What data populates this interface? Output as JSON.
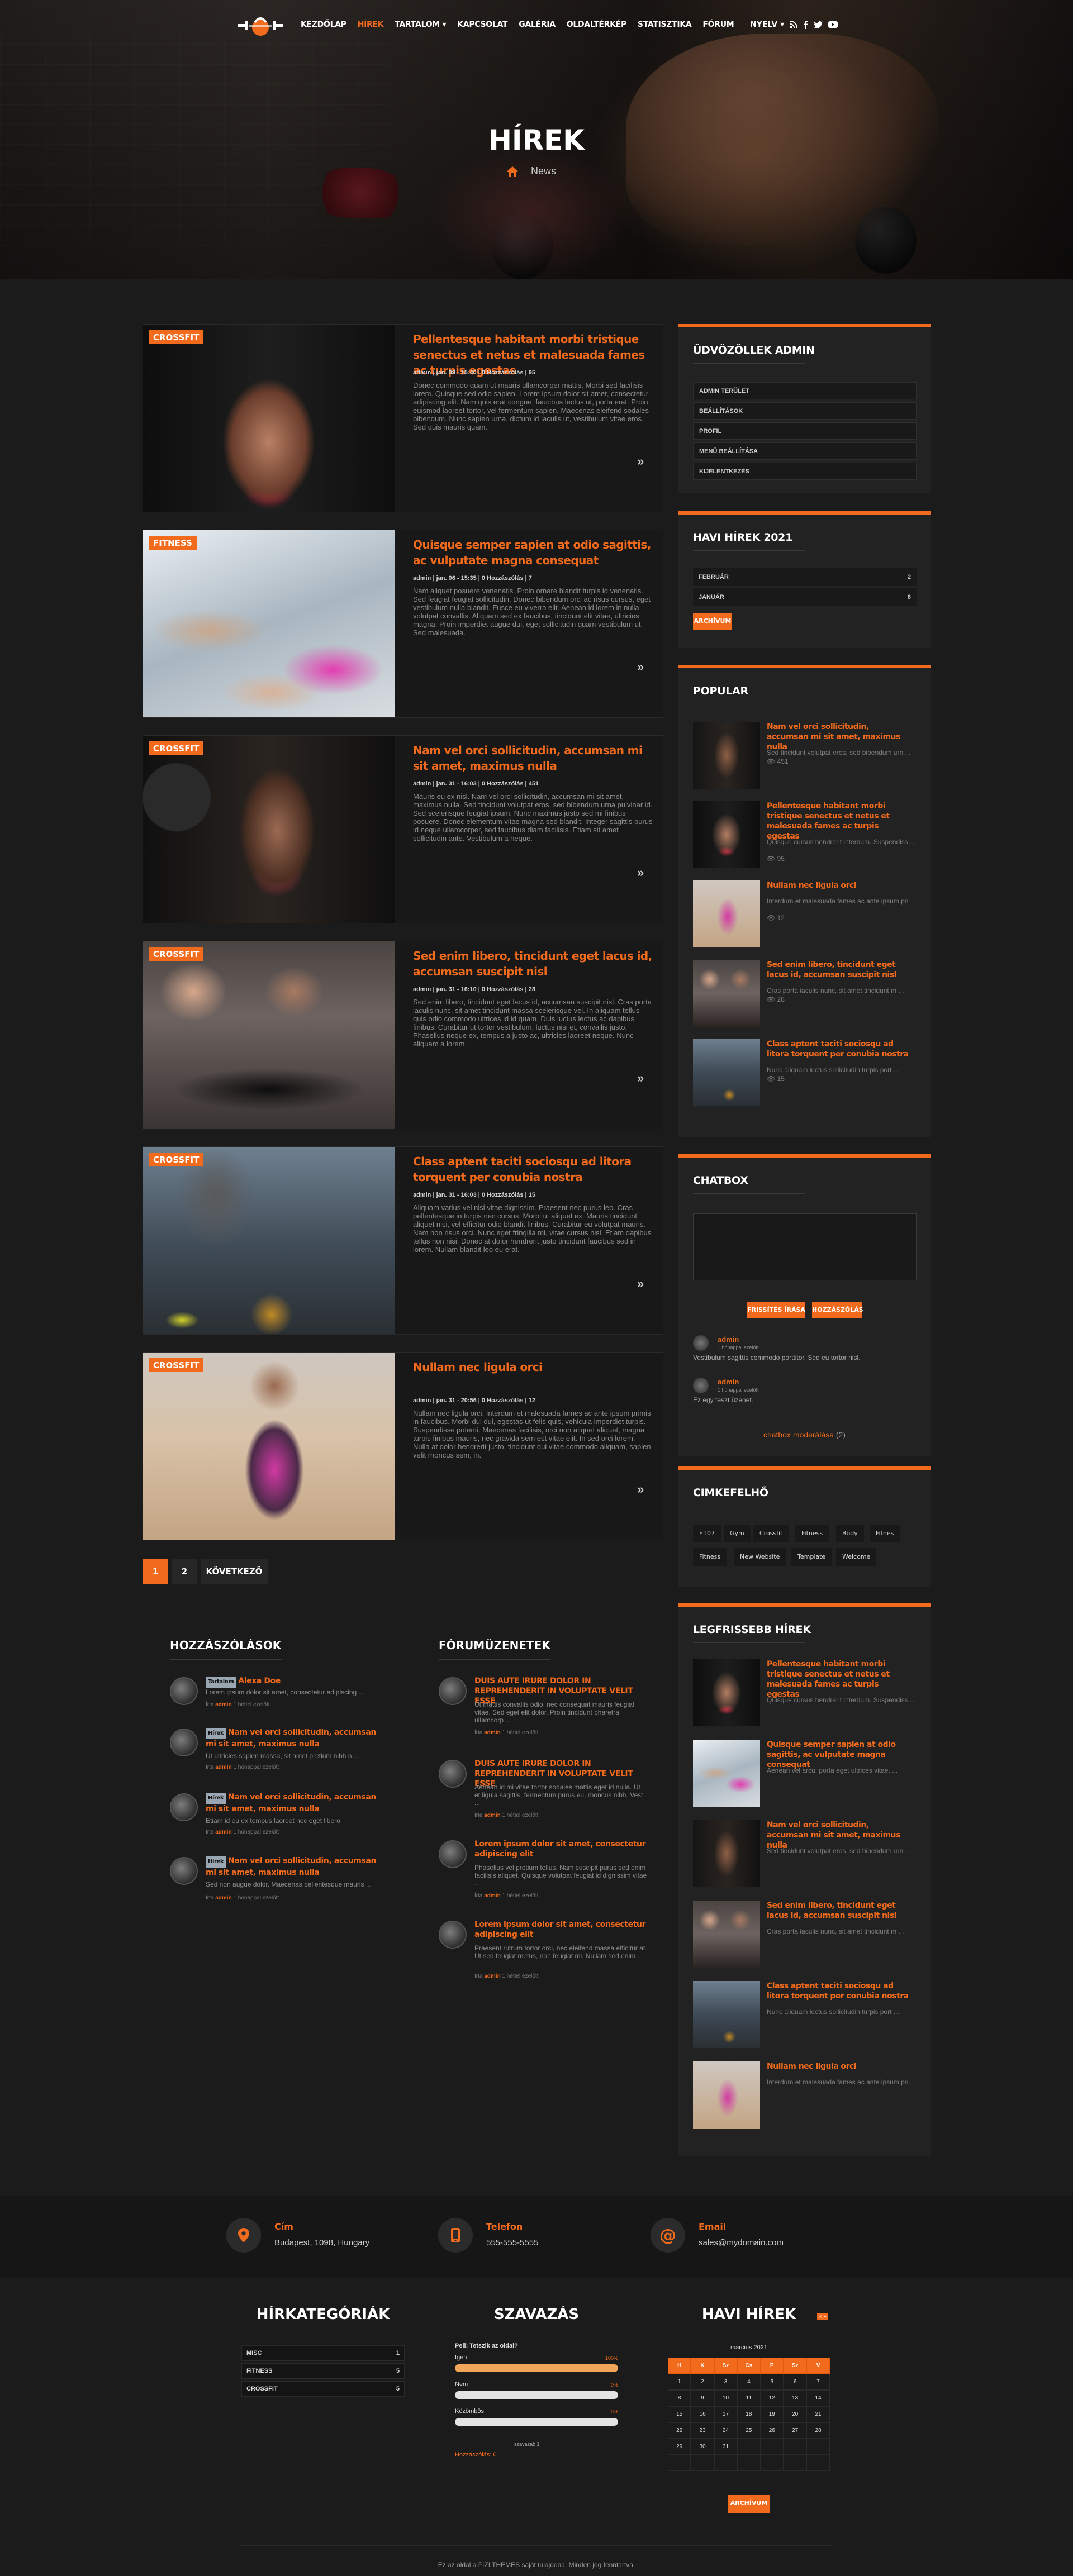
{
  "nav": {
    "items": [
      {
        "label": "KEZDŐLAP"
      },
      {
        "label": "HÍREK",
        "active": true
      },
      {
        "label": "TARTALOM ▾"
      },
      {
        "label": "KAPCSOLAT"
      },
      {
        "label": "GALÉRIA"
      },
      {
        "label": "OLDALTÉRKÉP"
      },
      {
        "label": "STATISZTIKA"
      },
      {
        "label": "FÓRUM"
      }
    ],
    "language": "NYELV ▾",
    "social_icons": [
      "rss-icon",
      "facebook-icon",
      "twitter-icon",
      "youtube-icon"
    ],
    "accent": "#f26a1b"
  },
  "hero": {
    "title": "HÍREK",
    "breadcrumb": "News"
  },
  "articles": [
    {
      "category": "CROSSFIT",
      "title": "Pellentesque habitant morbi tristique senectus et netus et malesuada fames ac turpis egestas",
      "meta": "admin | jan. 09 - 15:40 | 0 Hozzászólás | 95",
      "excerpt": "Donec commodo quam ut mauris ullamcorper mattis. Morbi sed facilisis lorem. Quisque sed odio sapien. Lorem ipsum dolor sit amet, consectetur adipiscing elit. Nam quis erat congue, faucibus lectus ut, porta erat. Proin euismod laoreet tortor, vel fermentum sapien. Maecenas eleifend sodales bibendum. Nunc sapien urna, dictum id iaculis ut, vestibulum vitae eros. Sed quis mauris quam."
    },
    {
      "category": "FITNESS",
      "title": "Quisque semper sapien at odio sagittis, ac vulputate magna consequat",
      "meta": "admin | jan. 06 - 15:35 | 0 Hozzászólás | 7",
      "excerpt": "Nam aliquet posuere venenatis. Proin ornare blandit turpis id venenatis. Sed feugiat feugiat sollicitudin. Donec bibendum orci ac risus cursus, eget vestibulum nulla blandit. Fusce eu viverra elit. Aenean id lorem in nulla volutpat convallis. Aliquam sed ex faucibus, tincidunt elit vitae, ultricies magna. Proin imperdiet augue dui, eget sollicitudin quam vestibulum ut. Sed malesuada."
    },
    {
      "category": "CROSSFIT",
      "title": "Nam vel orci sollicitudin, accumsan mi sit amet, maximus nulla",
      "meta": "admin | jan. 31 - 16:03 | 0 Hozzászólás | 451",
      "excerpt": "Mauris eu ex nisl. Nam vel orci sollicitudin, accumsan mi sit amet, maximus nulla. Sed tincidunt volutpat eros, sed bibendum urna pulvinar id. Sed scelerisque feugiat ipsum. Nunc maximus justo sed mi finibus posuere. Donec elementum vitae magna sed blandit. Integer sagittis purus id neque ullamcorper, sed faucibus diam facilisis. Etiam sit amet sollicitudin ante. Vestibulum a neque."
    },
    {
      "category": "CROSSFIT",
      "title": "Sed enim libero, tincidunt eget lacus id, accumsan suscipit nisl",
      "meta": "admin | jan. 31 - 16:10 | 0 Hozzászólás | 28",
      "excerpt": "Sed enim libero, tincidunt eget lacus id, accumsan suscipit nisl. Cras porta iaculis nunc, sit amet tincidunt massa scelerisque vel. In aliquam tellus quis odio commodo ultrices id id quam. Duis luctus lectus ac dapibus finibus. Curabitur ut tortor vestibulum, luctus nisi et, convallis justo. Phasellus neque ex, tempus a justo ac, ultricies laoreet neque. Nunc aliquam a lorem."
    },
    {
      "category": "CROSSFIT",
      "title": "Class aptent taciti sociosqu ad litora torquent per conubia nostra",
      "meta": "admin | jan. 31 - 16:03 | 0 Hozzászólás | 15",
      "excerpt": "Aliquam varius vel nisi vitae dignissim. Praesent nec purus leo. Cras pellentesque in turpis nec cursus. Morbi ut aliquet ex. Mauris tincidunt aliquet nisi, vel efficitur odio blandit finibus. Curabitur eu volutpat mauris. Nam non risus orci. Nunc eget fringilla mi, vitae cursus nisl. Etiam dapibus tellus non nisi. Donec at dolor hendrerit justo tincidunt faucibus sed in lorem. Nullam blandit leo eu erat."
    },
    {
      "category": "CROSSFIT",
      "title": "Nullam nec ligula orci",
      "meta": "admin | jan. 31 - 20:56 | 0 Hozzászólás | 12",
      "excerpt": "Nullam nec ligula orci. Interdum et malesuada fames ac ante ipsum primis in faucibus. Morbi dui dui, egestas ut felis quis, vehicula imperdiet turpis. Suspendisse potenti. Maecenas facilisis, orci non aliquet aliquet, magna turpis finibus mauris, nec gravida sem est vitae elit. In sed orci lorem. Nulla at dolor hendrerit justo, tincidunt dui vitae commodo aliquam, sapien velit rhoncus sem, in."
    }
  ],
  "pager": {
    "pages": [
      "1",
      "2"
    ],
    "next": "KÖVETKEZŐ"
  },
  "sidebar": {
    "admin": {
      "title": "ÜDVÖZÖLLEK ADMIN",
      "links": [
        "ADMIN TERÜLET",
        "BEÁLLÍTÁSOK",
        "PROFIL",
        "MENÜ BEÁLLÍTÁSA",
        "KIJELENTKEZÉS"
      ]
    },
    "monthly": {
      "title": "HAVI HÍREK 2021",
      "months": [
        {
          "name": "FEBRUÁR",
          "count": "2"
        },
        {
          "name": "JANUÁR",
          "count": "8"
        }
      ],
      "archive": "ARCHÍVUM"
    },
    "popular": {
      "title": "POPULAR",
      "items": [
        {
          "title": "Nam vel orci sollicitudin, accumsan mi sit amet, maximus nulla",
          "excerpt": "Sed tincidunt volutpat eros, sed bibendum urn ...",
          "views": "451"
        },
        {
          "title": "Pellentesque habitant morbi tristique senectus et netus et malesuada fames ac turpis egestas",
          "excerpt": "Quisque cursus hendrerit interdum. Suspendiss ...",
          "views": "95"
        },
        {
          "title": "Nullam nec ligula orci",
          "excerpt": "Interdum et malesuada fames ac ante ipsum pri ...",
          "views": "12"
        },
        {
          "title": "Sed enim libero, tincidunt eget lacus id, accumsan suscipit nisl",
          "excerpt": "Cras porta iaculis nunc, sit amet tincidunt m ...",
          "views": "28"
        },
        {
          "title": "Class aptent taciti sociosqu ad litora torquent per conubia nostra",
          "excerpt": "Nunc aliquam lectus sollicitudin turpis port ...",
          "views": "15"
        }
      ]
    },
    "chat": {
      "title": "CHATBOX",
      "refresh": "FRISSÍTÉS ÍRÁSA",
      "send": "HOZZÁSZÓLÁS",
      "messages": [
        {
          "user": "admin",
          "time": "1 hónappal ezelőtt",
          "text": "Vestibulum sagittis commodo porttitor. Sed eu tortor nisl."
        },
        {
          "user": "admin",
          "time": "1 hónappal ezelőtt",
          "text": "Ez egy teszt üzenet."
        }
      ],
      "moderate": "chatbox moderálása",
      "moderate_count": "(2)"
    },
    "tags": {
      "title": "CIMKEFELHŐ",
      "items": [
        "E107",
        "Gym",
        "Crossfit",
        "Fitness",
        "Body",
        "Fitnes",
        "Fitness",
        "New Website",
        "Template",
        "Welcome"
      ]
    },
    "latest": {
      "title": "LEGFRISSEBB HÍREK",
      "items": [
        {
          "title": "Pellentesque habitant morbi tristique senectus et netus et malesuada fames ac turpis egestas",
          "excerpt": "Quisque cursus hendrerit interdum. Suspendiss ..."
        },
        {
          "title": "Quisque semper sapien at odio sagittis, ac vulputate magna consequat",
          "excerpt": "Aenean vel arcu, porta eget ultrices vitae, ..."
        },
        {
          "title": "Nam vel orci sollicitudin, accumsan mi sit amet, maximus nulla",
          "excerpt": "Sed tincidunt volutpat eros, sed bibendum urn ..."
        },
        {
          "title": "Sed enim libero, tincidunt eget lacus id, accumsan suscipit nisl",
          "excerpt": "Cras porta iaculis nunc, sit amet tincidunt m ..."
        },
        {
          "title": "Class aptent taciti sociosqu ad litora torquent per conubia nostra",
          "excerpt": "Nunc aliquam lectus sollicitudin turpis port ..."
        },
        {
          "title": "Nullam nec ligula orci",
          "excerpt": "Interdum et malesuada fames ac ante ipsum pri ..."
        }
      ]
    }
  },
  "comments": {
    "title": "HOZZÁSZÓLÁSOK",
    "items": [
      {
        "badge": "Tartalom",
        "title": "Alexa Doe",
        "excerpt": "Lorem ipsum dolor sit amet, consectetur adipiscing ...",
        "by": "Írta",
        "user": "admin",
        "time": "1 héttel ezelőtt"
      },
      {
        "badge": "Hírek",
        "title": "Nam vel orci sollicitudin, accumsan mi sit amet, maximus nulla",
        "excerpt": "Ut ultricies sapien massa, sit amet pretium nibh n ...",
        "by": "Írta",
        "user": "admin",
        "time": "1 hónappal ezelőtt"
      },
      {
        "badge": "Hírek",
        "title": "Nam vel orci sollicitudin, accumsan mi sit amet, maximus nulla",
        "excerpt": "Etiam id eu ex tempus laoreet nec eget libero.",
        "by": "Írta",
        "user": "admin",
        "time": "1 hónappal ezelőtt"
      },
      {
        "badge": "Hírek",
        "title": "Nam vel orci sollicitudin, accumsan mi sit amet, maximus nulla",
        "excerpt": "Sed non augue dolor. Maecenas pellentesque mauris ...",
        "by": "Írta",
        "user": "admin",
        "time": "1 hónappal ezelőtt"
      }
    ]
  },
  "forum": {
    "title": "FÓRUMÜZENETEK",
    "items": [
      {
        "title": "DUIS AUTE IRURE DOLOR IN REPREHENDERIT IN VOLUPTATE VELIT ESSE",
        "excerpt": "Ut mattis convallis odio, nec consequat mauris feugiat vitae. Sed eget elit dolor. Proin tincidunt pharetra ullamcorp ...",
        "by": "Írta",
        "user": "admin",
        "time": "1 héttel ezelőtt"
      },
      {
        "title": "DUIS AUTE IRURE DOLOR IN REPREHENDERIT IN VOLUPTATE VELIT ESSE",
        "excerpt": "Aenean id mi vitae tortor sodales mattis eget id nulla. Ut et ligula sagittis, fermentum purus eu, rhoncus nibh. Vest ...",
        "by": "Írta",
        "user": "admin",
        "time": "1 héttel ezelőtt"
      },
      {
        "title": "Lorem ipsum dolor sit amet, consectetur adipiscing elit",
        "excerpt": "Phasellus vel pretium tellus. Nam suscipit purus sed enim facilisis aliquet. Quisque volutpat feugiat id dignissim vitae ...",
        "by": "Írta",
        "user": "admin",
        "time": "1 héttel ezelőtt"
      },
      {
        "title": "Lorem ipsum dolor sit amet, consectetur adipiscing elit",
        "excerpt": "Praesent rutrum tortor orci, nec eleifend massa efficitur at. Ut sed feugiat metus, non feugiat mi. Nullam sed enim ...",
        "by": "Írta",
        "user": "admin",
        "time": "1 héttel ezelőtt"
      }
    ]
  },
  "contact": [
    {
      "icon": "map-pin-icon",
      "label": "Cím",
      "value": "Budapest, 1098, Hungary"
    },
    {
      "icon": "phone-icon",
      "label": "Telefon",
      "value": "555-555-5555"
    },
    {
      "icon": "at-sign-icon",
      "label": "Email",
      "value": "sales@mydomain.com"
    }
  ],
  "footer": {
    "categories": {
      "title": "HÍRKATEGÓRIÁK",
      "items": [
        {
          "name": "MISC",
          "count": "1"
        },
        {
          "name": "FITNESS",
          "count": "5"
        },
        {
          "name": "CROSSFIT",
          "count": "5"
        }
      ]
    },
    "poll": {
      "title": "SZAVAZÁS",
      "question": "Pell: Tetszik az oldal?",
      "options": [
        {
          "label": "Igen",
          "percent": 100,
          "pct_text": "100%"
        },
        {
          "label": "Nem",
          "percent": 0,
          "pct_text": "0%"
        },
        {
          "label": "Közömbös",
          "percent": 0,
          "pct_text": "0%"
        }
      ],
      "votes": "szavazat: 1",
      "comments": "Hozzászólás: 0"
    },
    "calendar": {
      "title": "HAVI HÍREK",
      "nav": "« »",
      "month": "március 2021",
      "days": [
        "H",
        "K",
        "Sz",
        "Cs",
        "P",
        "Sz",
        "V"
      ],
      "weeks": [
        [
          "1",
          "2",
          "3",
          "4",
          "5",
          "6",
          "7"
        ],
        [
          "8",
          "9",
          "10",
          "11",
          "12",
          "13",
          "14"
        ],
        [
          "15",
          "16",
          "17",
          "18",
          "19",
          "20",
          "21"
        ],
        [
          "22",
          "23",
          "24",
          "25",
          "26",
          "27",
          "28"
        ],
        [
          "29",
          "30",
          "31",
          "",
          "",
          "",
          ""
        ],
        [
          "",
          "",
          "",
          "",
          "",
          "",
          ""
        ]
      ],
      "archive": "ARCHÍVUM"
    },
    "copyright": "Ez az oldal a FIZI THEMES saját tulajdona. Minden jog fenntartva."
  }
}
